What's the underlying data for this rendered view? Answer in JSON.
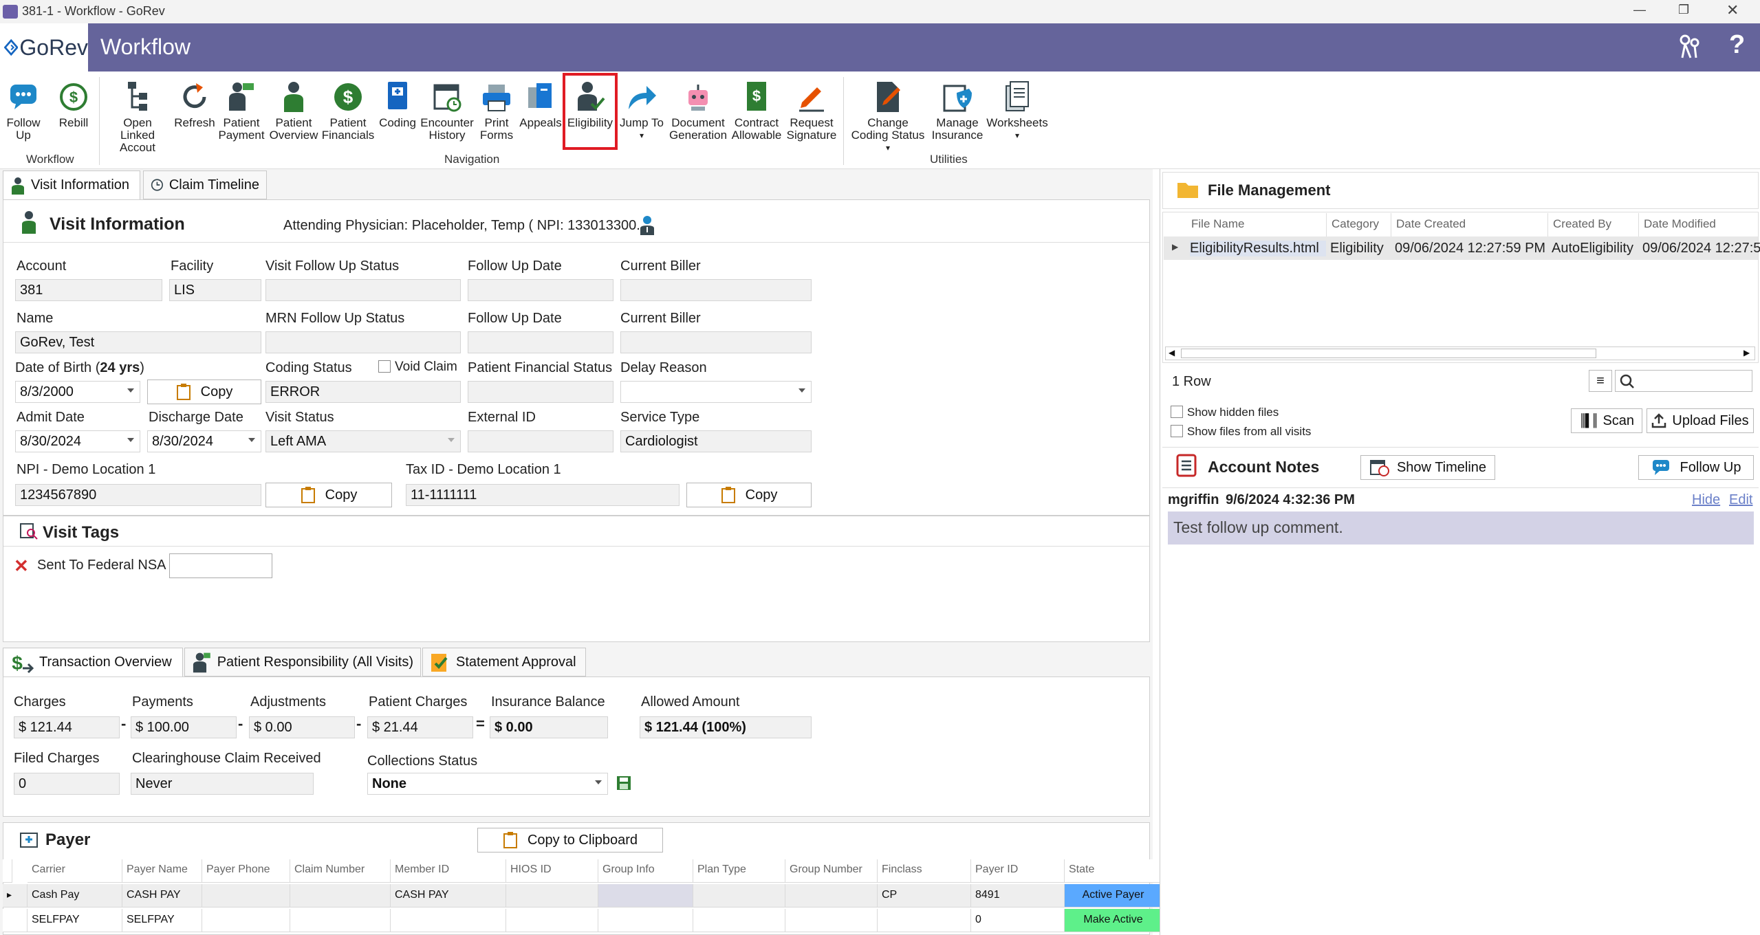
{
  "window": {
    "title": "381-1 - Workflow - GoRev",
    "min": "—",
    "max": "❐",
    "close": "✕"
  },
  "header": {
    "logo": "GoRev",
    "title": "Workflow"
  },
  "toolbar": {
    "follow_up": "Follow Up",
    "rebill": "Rebill",
    "open_linked": "Open Linked Accout",
    "refresh": "Refresh",
    "patient_payment": "Patient Payment",
    "patient_overview": "Patient Overview",
    "patient_financials": "Patient Financials",
    "coding": "Coding",
    "encounter_history": "Encounter History",
    "print_forms": "Print Forms",
    "appeals": "Appeals",
    "eligibility": "Eligibility",
    "jump_to": "Jump To",
    "document_generation": "Document Generation",
    "contract_allowable": "Contract Allowable",
    "request_signature": "Request Signature",
    "change_coding_status": "Change Coding Status",
    "manage_insurance": "Manage Insurance",
    "worksheets": "Worksheets",
    "group_workflow": "Workflow",
    "group_navigation": "Navigation",
    "group_utilities": "Utilities"
  },
  "tabs": {
    "visit_information": "Visit Information",
    "claim_timeline": "Claim Timeline"
  },
  "visit": {
    "heading": "Visit Information",
    "attending": "Attending Physician: Placeholder, Temp ( NPI: 133013300...",
    "account_label": "Account",
    "account": "381",
    "facility_label": "Facility",
    "facility": "LIS",
    "visit_follow_up_status_label": "Visit Follow Up Status",
    "visit_follow_up_status": "",
    "follow_up_date_label": "Follow Up Date",
    "follow_up_date": "",
    "current_biller_label": "Current Biller",
    "current_biller": "",
    "name_label": "Name",
    "name": "GoRev, Test",
    "mrn_follow_up_status_label": "MRN Follow Up Status",
    "mrn_follow_up_status": "",
    "follow_up_date2_label": "Follow Up Date",
    "follow_up_date2": "",
    "current_biller2_label": "Current Biller",
    "current_biller2": "",
    "dob_label": "Date of Birth (",
    "dob_age": "24 yrs",
    "dob_close": ")",
    "dob": "8/3/2000",
    "copy": "Copy",
    "coding_status_label": "Coding Status",
    "coding_status": "ERROR",
    "void_claim": "Void Claim",
    "patient_financial_status_label": "Patient Financial Status",
    "patient_financial_status": "",
    "delay_reason_label": "Delay Reason",
    "delay_reason": "",
    "admit_date_label": "Admit Date",
    "admit_date": "8/30/2024",
    "discharge_date_label": "Discharge Date",
    "discharge_date": "8/30/2024",
    "visit_status_label": "Visit Status",
    "visit_status": "Left AMA",
    "external_id_label": "External ID",
    "external_id": "",
    "service_type_label": "Service Type",
    "service_type": "Cardiologist",
    "npi_label": "NPI - Demo Location 1",
    "npi": "1234567890",
    "tax_label": "Tax ID - Demo Location 1",
    "tax": "11-1111111"
  },
  "tags": {
    "heading": "Visit Tags",
    "tag1": "Sent To Federal NSA",
    "tag1_value": ""
  },
  "tx_tabs": {
    "overview": "Transaction Overview",
    "patient_resp": "Patient Responsibility (All Visits)",
    "statement": "Statement Approval"
  },
  "tx": {
    "charges_label": "Charges",
    "charges": "$ 121.44",
    "payments_label": "Payments",
    "payments": "$ 100.00",
    "adjustments_label": "Adjustments",
    "adjustments": "$ 0.00",
    "patient_charges_label": "Patient Charges",
    "patient_charges": "$ 21.44",
    "insurance_balance_label": "Insurance Balance",
    "insurance_balance": "$ 0.00",
    "allowed_amount_label": "Allowed Amount",
    "allowed_amount": "$ 121.44 (100%)",
    "minus": "-",
    "equals": "=",
    "filed_charges_label": "Filed Charges",
    "filed_charges": "0",
    "clearinghouse_label": "Clearinghouse Claim Received",
    "clearinghouse": "Never",
    "collections_label": "Collections Status",
    "collections": "None"
  },
  "payer": {
    "heading": "Payer",
    "copy_clipboard": "Copy to Clipboard",
    "columns": [
      "Carrier",
      "Payer Name",
      "Payer Phone",
      "Claim Number",
      "Member ID",
      "HIOS ID",
      "Group Info",
      "Plan Type",
      "Group Number",
      "Finclass",
      "Payer ID",
      "State"
    ],
    "rows": [
      [
        "Cash Pay",
        "CASH PAY",
        "",
        "",
        "CASH PAY",
        "",
        "",
        "",
        "",
        "CP",
        "8491",
        "Active Payer"
      ],
      [
        "SELFPAY",
        "SELFPAY",
        "",
        "",
        "",
        "",
        "",
        "",
        "",
        "",
        "0",
        "Make Active"
      ]
    ],
    "active_color": "#5aa9ff",
    "make_active_color": "#5ef08a"
  },
  "files": {
    "heading": "File Management",
    "columns": [
      "File Name",
      "Category",
      "Date Created",
      "Created By",
      "Date Modified"
    ],
    "row": [
      "EligibilityResults.html",
      "Eligibility",
      "09/06/2024 12:27:59 PM",
      "AutoEligibility",
      "09/06/2024 12:27:5"
    ],
    "count": "1 Row",
    "search_value": "",
    "show_hidden": "Show hidden files",
    "show_all_visits": "Show files from all visits",
    "scan": "Scan",
    "upload": "Upload Files"
  },
  "notes": {
    "heading": "Account Notes",
    "show_timeline": "Show Timeline",
    "follow_up": "Follow Up",
    "author": "mgriffin",
    "timestamp": "9/6/2024 4:32:36 PM",
    "hide": "Hide",
    "edit": "Edit",
    "text": "Test follow up comment."
  },
  "colors": {
    "header": "#65649b",
    "highlight": "#e01b24",
    "note_bg": "#d3d2e6"
  }
}
